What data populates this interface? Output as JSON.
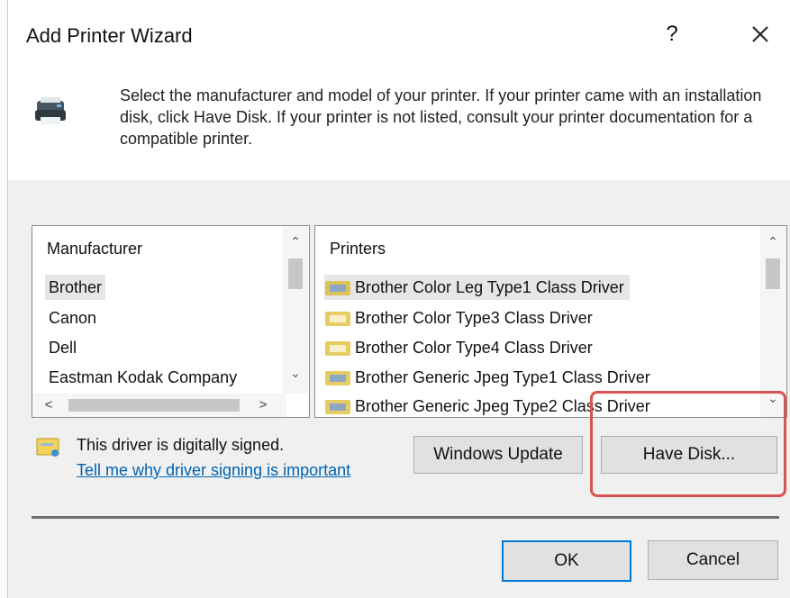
{
  "window": {
    "title": "Add Printer Wizard",
    "help_label": "?",
    "close_icon": "close-icon"
  },
  "header": {
    "icon": "printer-icon",
    "instructions": "Select the manufacturer and model of your printer. If your printer came with an installation disk, click Have Disk. If your printer is not listed, consult your printer documentation for a compatible printer."
  },
  "manufacturer_list": {
    "header": "Manufacturer",
    "items": [
      "Brother",
      "Canon",
      "Dell",
      "Eastman Kodak Company"
    ],
    "selected": "Brother"
  },
  "printers_list": {
    "header": "Printers",
    "items": [
      "Brother Color Leg Type1 Class Driver",
      "Brother Color Type3 Class Driver",
      "Brother Color Type4 Class Driver",
      "Brother Generic Jpeg Type1 Class Driver",
      "Brother Generic Jpeg Type2 Class Driver"
    ],
    "selected": "Brother Color Leg Type1 Class Driver"
  },
  "signing": {
    "status": "This driver is digitally signed.",
    "link": "Tell me why driver signing is important",
    "icon": "certificate-icon"
  },
  "buttons": {
    "windows_update": "Windows Update",
    "have_disk": "Have Disk...",
    "ok": "OK",
    "cancel": "Cancel"
  },
  "colors": {
    "link": "#0063b1",
    "default_button_border": "#0078d7",
    "highlight_annotation": "#d9534f"
  }
}
